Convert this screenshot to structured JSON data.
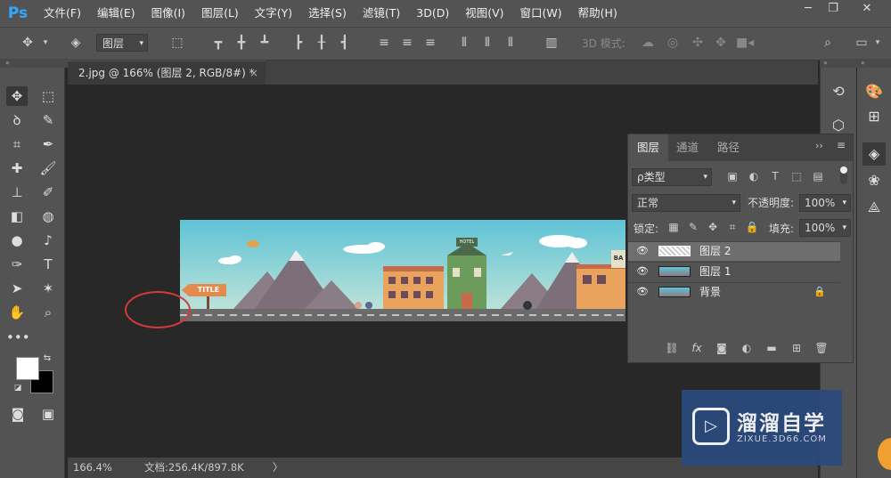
{
  "app": {
    "logo": "Ps"
  },
  "menu": [
    "文件(F)",
    "编辑(E)",
    "图像(I)",
    "图层(L)",
    "文字(Y)",
    "选择(S)",
    "滤镜(T)",
    "3D(D)",
    "视图(V)",
    "窗口(W)",
    "帮助(H)"
  ],
  "window_controls": {
    "minimize": "─",
    "restore": "❐",
    "close": "✕"
  },
  "options": {
    "layer_select": "图层",
    "mode_3d": "3D 模式:"
  },
  "document": {
    "tab_title": "2.jpg @ 166% (图层 2, RGB/8#) *",
    "close": "×"
  },
  "status": {
    "zoom": "166.4%",
    "doc_info": "文档:256.4K/897.8K",
    "arrow": "〉"
  },
  "canvas": {
    "sign": "TITLE",
    "hotel": "HOTEL",
    "bar": "BA"
  },
  "layers_panel": {
    "tabs": [
      "图层",
      "通道",
      "路径"
    ],
    "filter_kind": "ρ类型",
    "blend_mode": "正常",
    "opacity_label": "不透明度:",
    "opacity_value": "100%",
    "lock_label": "锁定:",
    "fill_label": "填充:",
    "fill_value": "100%",
    "layers": [
      {
        "name": "图层 2",
        "selected": true
      },
      {
        "name": "图层 1",
        "selected": false
      },
      {
        "name": "背景",
        "selected": false,
        "locked": true
      }
    ]
  },
  "watermark": {
    "title": "溜溜自学",
    "url": "ZIXUE.3D66.COM"
  },
  "colors": {
    "accent": "#31a8ff",
    "panel": "#535353",
    "canvas_bg": "#282828",
    "annotation": "#d43a3a",
    "watermark": "#2a4a7e"
  }
}
